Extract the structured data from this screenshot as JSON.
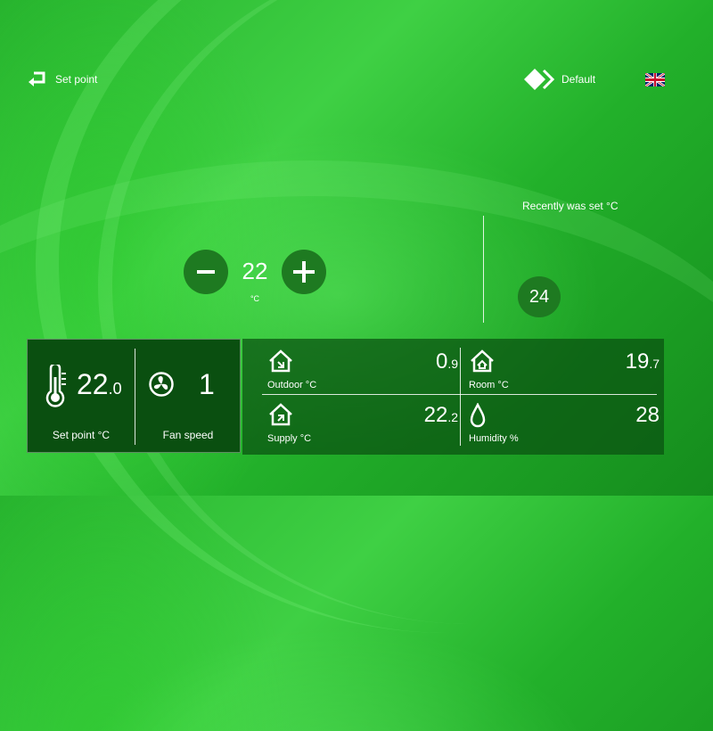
{
  "header": {
    "back_label": "Set point",
    "profile_label": "Default",
    "language_icon": "uk-flag-icon"
  },
  "setpoint_control": {
    "value": "22",
    "unit": "°C"
  },
  "recent": {
    "label": "Recently was set °C",
    "value": "24"
  },
  "status_panel": {
    "setpoint_int": "22",
    "setpoint_dec": ".0",
    "setpoint_label": "Set point °C",
    "fan_value": "1",
    "fan_label": "Fan speed"
  },
  "sensors": {
    "outdoor": {
      "int": "0",
      "dec": ".9",
      "label": "Outdoor °C",
      "icon": "house-outdoor-icon"
    },
    "room": {
      "int": "19",
      "dec": ".7",
      "label": "Room °C",
      "icon": "house-room-icon"
    },
    "supply": {
      "int": "22",
      "dec": ".2",
      "label": "Supply °C",
      "icon": "house-supply-icon"
    },
    "humidity": {
      "int": "28",
      "dec": "",
      "label": "Humidity %",
      "icon": "droplet-icon"
    }
  },
  "colors": {
    "background": "#2fbf36",
    "button": "#1e7a21",
    "panel_dark": "#0a4f10"
  }
}
